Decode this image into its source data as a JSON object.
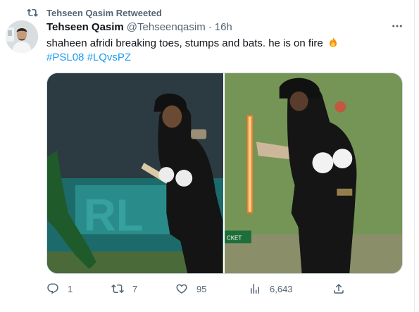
{
  "retweet_label": "Tehseen Qasim Retweeted",
  "author": {
    "name": "Tehseen Qasim",
    "handle": "@Tehseenqasim",
    "separator": "·",
    "time": "16h"
  },
  "tweet_text": "shaheen afridi breaking toes, stumps and bats. he is on fire",
  "hashtags": [
    "#PSL08",
    "#LQvsPZ"
  ],
  "stats": {
    "replies": "1",
    "retweets": "7",
    "likes": "95",
    "views": "6,643"
  },
  "colors": {
    "link": "#1d9bf0",
    "secondary_text": "#536471",
    "primary_text": "#0f1419"
  },
  "icons": [
    "retweet-icon",
    "more-icon",
    "fire-emoji-icon",
    "reply-icon",
    "like-icon",
    "views-icon",
    "share-icon"
  ]
}
